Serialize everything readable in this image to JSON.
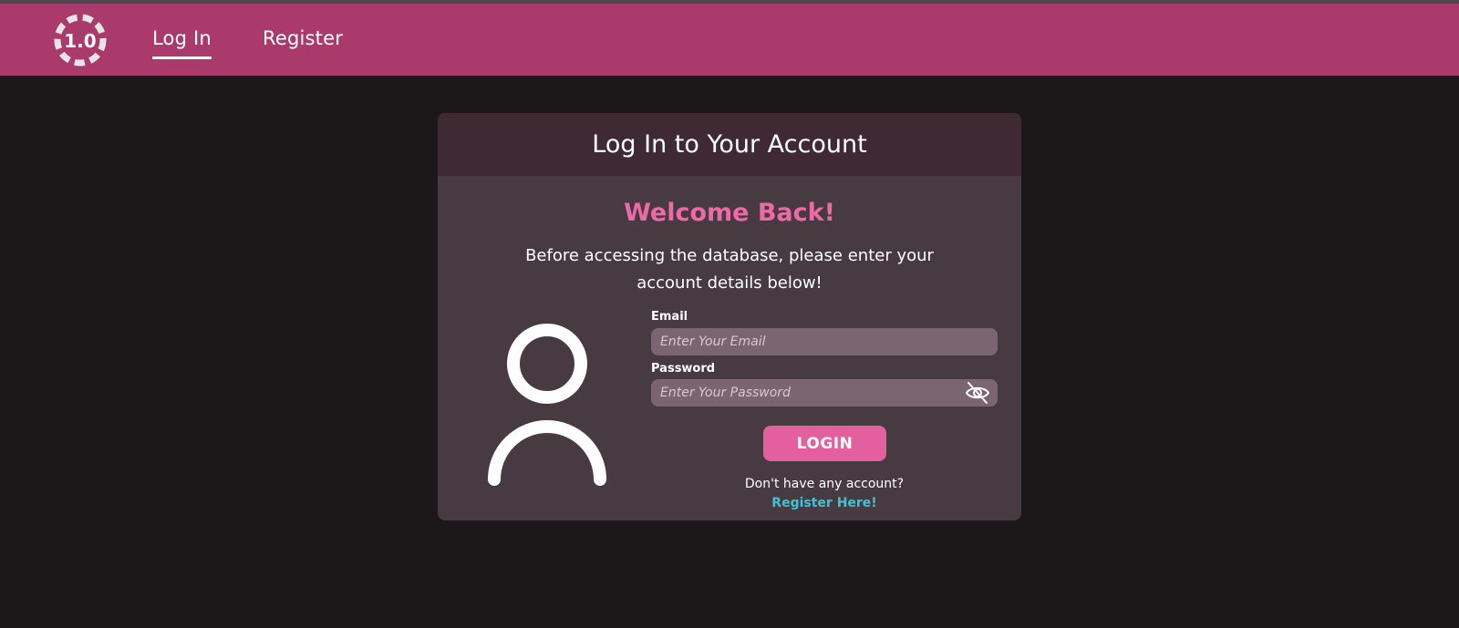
{
  "navbar": {
    "logo_text": "1.0",
    "links": [
      {
        "label": "Log In",
        "active": true
      },
      {
        "label": "Register",
        "active": false
      }
    ],
    "background": "#ab3a6c"
  },
  "card": {
    "title": "Log In to Your Account",
    "welcome": "Welcome Back!",
    "intro": "Before accessing the database, please enter your account details below!",
    "avatar_icon": "user-outline-icon",
    "email": {
      "label": "Email",
      "placeholder": "Enter Your Email",
      "value": ""
    },
    "password": {
      "label": "Password",
      "placeholder": "Enter Your Password",
      "value": "",
      "toggle_icon": "eye-off-icon"
    },
    "login_button": "LOGIN",
    "no_account_text": "Don't have any account?",
    "register_link": "Register Here!"
  },
  "colors": {
    "accent": "#e45f9d",
    "welcome": "#ee6aa7",
    "link": "#3fc3d9",
    "background": "#1c1819",
    "card": "#473a41",
    "card_header": "#3f2a33"
  }
}
